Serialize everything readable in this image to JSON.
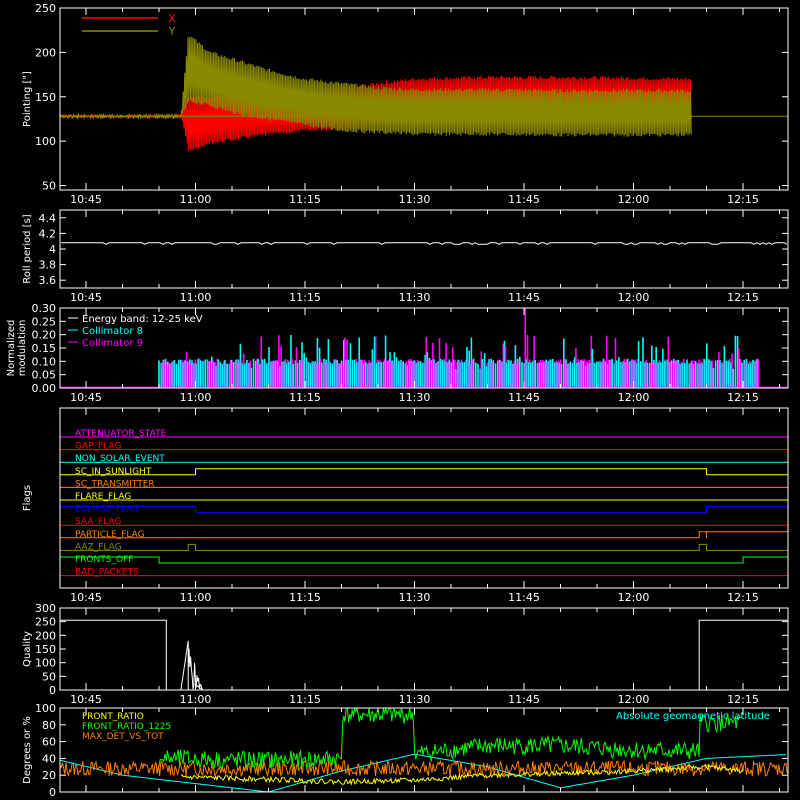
{
  "figure": {
    "background": "#000000",
    "foreground": "#ffffff",
    "time_ticks": [
      "10:45",
      "11:00",
      "11:15",
      "11:30",
      "11:45",
      "12:00",
      "12:15"
    ]
  },
  "chart_data": [
    {
      "id": "pointing",
      "type": "line",
      "title": "",
      "ylabel": "Pointing [\"]",
      "ylim": [
        45,
        250
      ],
      "yticks": [
        50,
        100,
        150,
        200,
        250
      ],
      "legend": {
        "placement": "top-left",
        "entries": [
          {
            "name": "X",
            "color": "#ff0000"
          },
          {
            "name": "Y",
            "color": "#8a8a00"
          }
        ]
      },
      "series": [
        {
          "name": "X",
          "color": "#ff0000",
          "x": [
            "10:38",
            "10:58",
            "10:59",
            "11:02",
            "11:06",
            "11:10",
            "11:15",
            "11:20",
            "11:25",
            "11:30",
            "11:40",
            "11:50",
            "12:00",
            "12:08"
          ],
          "y_upper": [
            128,
            128,
            150,
            150,
            150,
            150,
            152,
            158,
            165,
            170,
            172,
            172,
            171,
            170
          ],
          "y_lower": [
            128,
            128,
            88,
            98,
            103,
            108,
            112,
            115,
            118,
            120,
            121,
            122,
            122,
            123
          ]
        },
        {
          "name": "Y",
          "color": "#8a8a00",
          "x": [
            "10:38",
            "10:58",
            "10:59",
            "11:02",
            "11:06",
            "11:10",
            "11:15",
            "11:20",
            "11:25",
            "11:30",
            "11:40",
            "11:50",
            "12:00",
            "12:08"
          ],
          "y_upper": [
            128,
            128,
            220,
            200,
            190,
            180,
            170,
            165,
            160,
            158,
            158,
            157,
            157,
            157
          ],
          "y_lower": [
            128,
            128,
            145,
            140,
            130,
            125,
            118,
            112,
            110,
            108,
            108,
            107,
            107,
            107
          ]
        },
        {
          "name": "baseline",
          "color": "#8a8a00",
          "x": [
            "10:38",
            "10:58",
            "12:08",
            "12:22"
          ],
          "y": [
            128,
            128,
            128,
            128
          ]
        }
      ]
    },
    {
      "id": "roll",
      "type": "line",
      "title": "",
      "ylabel": "Roll period [s]",
      "ylim": [
        3.5,
        4.5
      ],
      "yticks": [
        3.6,
        3.8,
        4.0,
        4.2,
        4.4
      ],
      "series": [
        {
          "name": "",
          "color": "#ffffff",
          "x": [
            "10:38",
            "12:22"
          ],
          "y": [
            4.08,
            4.08
          ]
        }
      ]
    },
    {
      "id": "modulation",
      "type": "bar",
      "title": "",
      "ylabel": "Normalized modulation",
      "ylim": [
        0,
        0.3
      ],
      "yticks": [
        "0.00",
        "0.05",
        "0.10",
        "0.15",
        "0.20",
        "0.25",
        "0.30"
      ],
      "annotations": [
        "Energy band: 12-25 keV"
      ],
      "legend": {
        "placement": "top-left",
        "entries": [
          {
            "name": "Collimator 8",
            "color": "#00ffff"
          },
          {
            "name": "Collimator 9",
            "color": "#ff00ff"
          }
        ]
      },
      "x_range": [
        "10:55",
        "12:17"
      ],
      "series": [
        {
          "name": "Collimator 8",
          "color": "#00ffff",
          "typical": 0.1,
          "range": [
            0.07,
            0.2
          ]
        },
        {
          "name": "Collimator 9",
          "color": "#ff00ff",
          "typical": 0.1,
          "range": [
            0.0,
            0.3
          ],
          "max_x": "11:45"
        }
      ]
    },
    {
      "id": "flags",
      "type": "step",
      "title": "",
      "ylabel": "Flags",
      "flags": [
        {
          "label": "ATTENUATOR_STATE",
          "color": "#ff00ff",
          "on": []
        },
        {
          "label": "GAP_FLAG",
          "color": "#ff0000",
          "on": []
        },
        {
          "label": "NON_SOLAR_EVENT",
          "color": "#00ffff",
          "on": []
        },
        {
          "label": "SC_IN_SUNLIGHT",
          "color": "#ffff00",
          "on": [
            [
              "11:00",
              "12:10"
            ]
          ]
        },
        {
          "label": "SC_TRANSMITTER",
          "color": "#ff8000",
          "on": []
        },
        {
          "label": "FLARE_FLAG",
          "color": "#ffff00",
          "on": []
        },
        {
          "label": "ECLIPSE_FLAG",
          "color": "#0000ff",
          "on": [
            [
              "10:38",
              "11:00"
            ],
            [
              "12:10",
              "12:22"
            ]
          ]
        },
        {
          "label": "SAA_FLAG",
          "color": "#ff0000",
          "on": []
        },
        {
          "label": "PARTICLE_FLAG",
          "color": "#ff8000",
          "on": [
            [
              "12:09",
              "12:10"
            ],
            [
              "12:10",
              "12:22"
            ]
          ]
        },
        {
          "label": "AAZ_FLAG",
          "color": "#8a8a00",
          "on": [
            [
              "10:59",
              "11:00"
            ],
            [
              "12:09",
              "12:10"
            ]
          ]
        },
        {
          "label": "FRONTS_OFF",
          "color": "#00ff00",
          "on": [
            [
              "10:38",
              "10:55"
            ],
            [
              "12:15",
              "12:22"
            ]
          ]
        },
        {
          "label": "BAD_PACKETS",
          "color": "#ff0000",
          "on": []
        }
      ]
    },
    {
      "id": "quality",
      "type": "line",
      "title": "",
      "ylabel": "Quality",
      "ylim": [
        0,
        300
      ],
      "yticks": [
        0,
        50,
        100,
        150,
        200,
        250,
        300
      ],
      "series": [
        {
          "name": "",
          "color": "#ffffff",
          "x": [
            "10:38",
            "10:56",
            "10:56",
            "10:58",
            "10:59",
            "11:00",
            "11:01",
            "12:09",
            "12:09",
            "12:22"
          ],
          "y": [
            255,
            255,
            0,
            0,
            180,
            20,
            0,
            0,
            255,
            255
          ]
        }
      ]
    },
    {
      "id": "ratios",
      "type": "line",
      "title": "",
      "ylabel": "Degrees or %",
      "ylim": [
        0,
        100
      ],
      "yticks": [
        0,
        20,
        40,
        60,
        80,
        100
      ],
      "legend": {
        "placement": "top-left",
        "entries": [
          {
            "name": "FRONT_RATIO",
            "color": "#ffff00"
          },
          {
            "name": "FRONT_RATIO_1225",
            "color": "#00ff00"
          },
          {
            "name": "MAX_DET_VS_TOT",
            "color": "#ff8000"
          }
        ]
      },
      "annotations": [
        "Absolute geomagnetic latitude"
      ],
      "series": [
        {
          "name": "FRONT_RATIO_1225",
          "color": "#00ff00",
          "x": [
            "10:55",
            "11:05",
            "11:15",
            "11:20",
            "11:20",
            "11:30",
            "11:30",
            "11:40",
            "11:50",
            "12:00",
            "12:09",
            "12:09",
            "12:15"
          ],
          "y": [
            40,
            38,
            38,
            40,
            92,
            92,
            45,
            55,
            55,
            50,
            48,
            82,
            82
          ]
        },
        {
          "name": "MAX_DET_VS_TOT",
          "color": "#ff8000",
          "x": [
            "10:38",
            "12:22"
          ],
          "y": [
            28,
            28
          ]
        },
        {
          "name": "FRONT_RATIO",
          "color": "#ffff00",
          "x": [
            "10:58",
            "11:10",
            "11:20",
            "11:30",
            "11:40",
            "11:50",
            "12:00",
            "12:10",
            "12:15"
          ],
          "y": [
            18,
            15,
            12,
            14,
            20,
            22,
            25,
            30,
            25
          ]
        },
        {
          "name": "Absolute geomagnetic latitude",
          "color": "#00ffff",
          "x": [
            "10:38",
            "10:50",
            "11:00",
            "11:10",
            "11:20",
            "11:30",
            "11:40",
            "11:50",
            "12:00",
            "12:10",
            "12:22"
          ],
          "y": [
            45,
            20,
            10,
            0,
            25,
            45,
            30,
            5,
            20,
            40,
            45
          ]
        }
      ]
    }
  ]
}
